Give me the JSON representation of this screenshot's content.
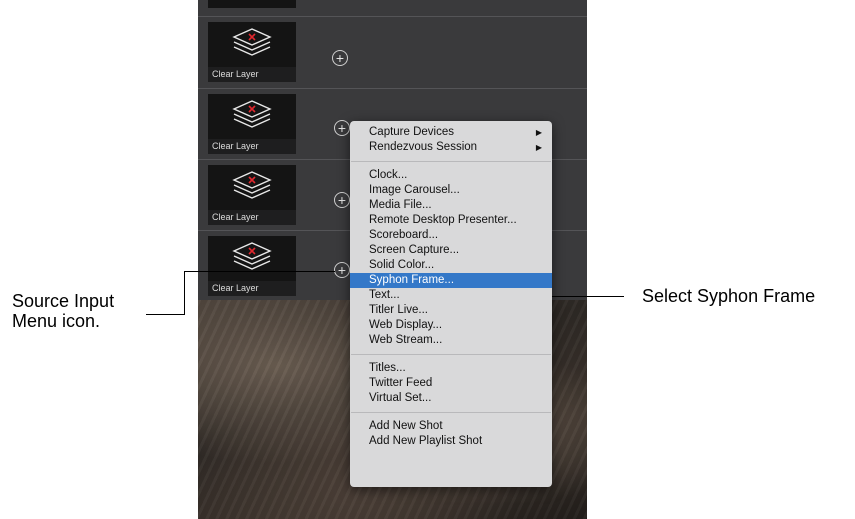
{
  "rows": [
    {
      "thumb_label": "Clear Layer"
    },
    {
      "thumb_label": "Clear Layer"
    },
    {
      "thumb_label": "Clear Layer"
    },
    {
      "thumb_label": "Clear Layer"
    }
  ],
  "plus_glyph": "+",
  "menu": {
    "groups": [
      [
        {
          "label": "Capture Devices",
          "submenu": true
        },
        {
          "label": "Rendezvous Session",
          "submenu": true
        }
      ],
      [
        {
          "label": "Clock..."
        },
        {
          "label": "Image Carousel..."
        },
        {
          "label": "Media File..."
        },
        {
          "label": "Remote Desktop Presenter..."
        },
        {
          "label": "Scoreboard..."
        },
        {
          "label": "Screen Capture..."
        },
        {
          "label": "Solid Color..."
        },
        {
          "label": "Syphon Frame...",
          "selected": true
        },
        {
          "label": "Text..."
        },
        {
          "label": "Titler Live..."
        },
        {
          "label": "Web Display..."
        },
        {
          "label": "Web Stream..."
        }
      ],
      [
        {
          "label": "Titles..."
        },
        {
          "label": "Twitter Feed"
        },
        {
          "label": "Virtual Set..."
        }
      ],
      [
        {
          "label": "Add New Shot"
        },
        {
          "label": "Add New Playlist Shot"
        }
      ]
    ],
    "submenu_arrow": "▶",
    "selected_color": "#3478c8"
  },
  "callouts": {
    "left": [
      "Source Input",
      "Menu icon."
    ],
    "right": "Select Syphon Frame"
  },
  "icons": {
    "layers": "layers-stack-icon",
    "clear": "red-x-icon",
    "add": "plus-circle-icon"
  }
}
